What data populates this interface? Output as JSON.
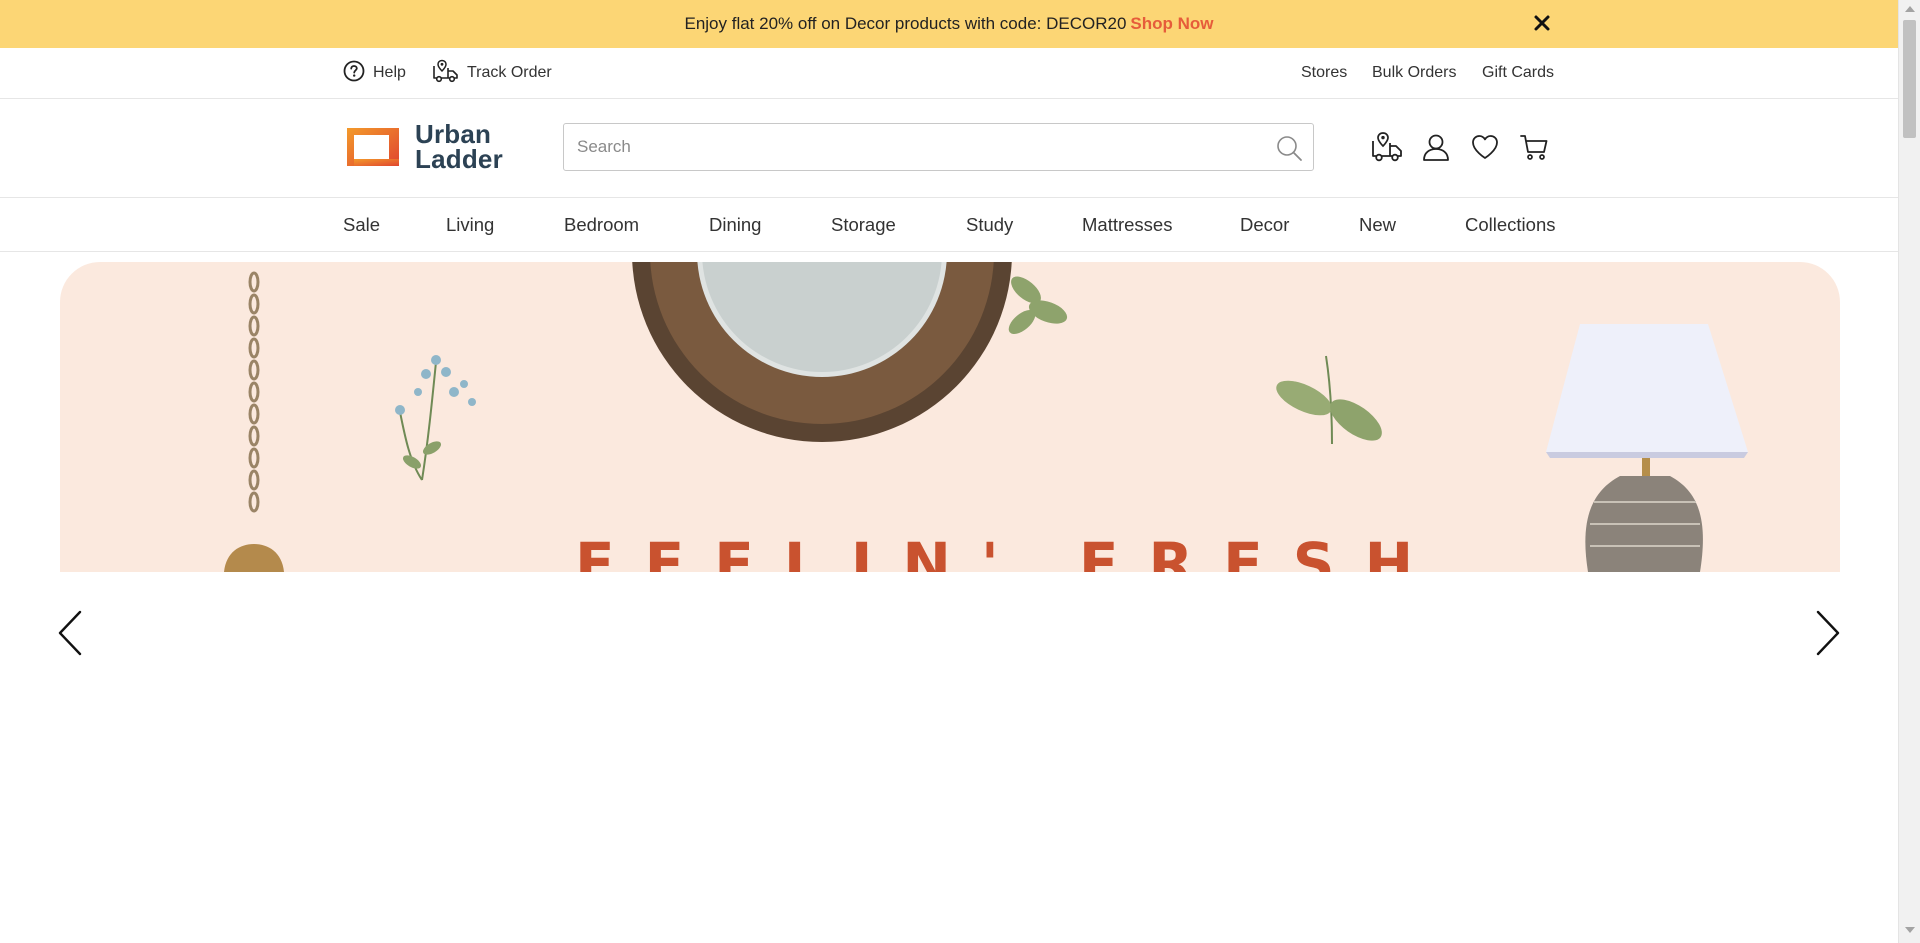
{
  "promo": {
    "message": "Enjoy flat 20% off on Decor products with code: DECOR20",
    "cta": "Shop Now",
    "close_icon": "close-icon"
  },
  "utility_bar": {
    "left": [
      {
        "label": "Help",
        "icon": "help-circle-icon"
      },
      {
        "label": "Track Order",
        "icon": "delivery-truck-icon"
      }
    ],
    "right": [
      {
        "label": "Stores"
      },
      {
        "label": "Bulk Orders"
      },
      {
        "label": "Gift Cards"
      }
    ]
  },
  "header": {
    "logo_line1": "Urban",
    "logo_line2": "Ladder",
    "search": {
      "placeholder": "Search",
      "value": ""
    },
    "icons": [
      "store-locator-truck-icon",
      "user-account-icon",
      "wishlist-heart-icon",
      "cart-icon"
    ]
  },
  "nav": {
    "items": [
      "Sale",
      "Living",
      "Bedroom",
      "Dining",
      "Storage",
      "Study",
      "Mattresses",
      "Decor",
      "New",
      "Collections"
    ]
  },
  "hero": {
    "headline": "FEELIN' FRESH"
  },
  "carousel": {
    "prev_icon": "chevron-left-icon",
    "next_icon": "chevron-right-icon"
  },
  "colors": {
    "promo_bg": "#fcd675",
    "accent": "#e65c3a",
    "logo_text": "#2c4254",
    "hero_bg": "#fbe9de",
    "hero_text": "#c9522f"
  }
}
